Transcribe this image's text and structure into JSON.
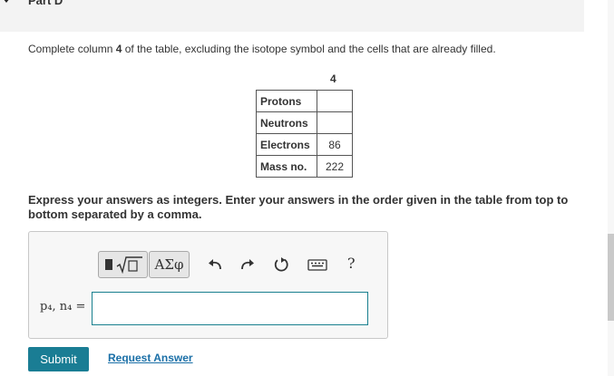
{
  "header": {
    "part_title": "Part D"
  },
  "instruction": {
    "prefix": "Complete column ",
    "column": "4",
    "suffix": " of the table, excluding the isotope symbol and the cells that are already filled."
  },
  "table": {
    "column_header": "4",
    "rows": [
      {
        "label": "Protons",
        "value": ""
      },
      {
        "label": "Neutrons",
        "value": ""
      },
      {
        "label": "Electrons",
        "value": "86"
      },
      {
        "label": "Mass no.",
        "value": "222"
      }
    ]
  },
  "prompt": "Express your answers as integers. Enter your answers in the order given in the table from top to bottom separated by a comma.",
  "toolbar": {
    "greek_label": "ΑΣφ",
    "help_label": "?",
    "icons": [
      "templates-icon",
      "greek-symbols-icon",
      "undo-icon",
      "redo-icon",
      "reset-icon",
      "keyboard-icon",
      "help-icon"
    ]
  },
  "answer": {
    "variable_label": "p₄, n₄ =",
    "value": ""
  },
  "actions": {
    "submit_label": "Submit",
    "request_label": "Request Answer"
  },
  "colors": {
    "accent": "#1a7d94",
    "link": "#1a6fa7",
    "input_border": "#19808f"
  }
}
